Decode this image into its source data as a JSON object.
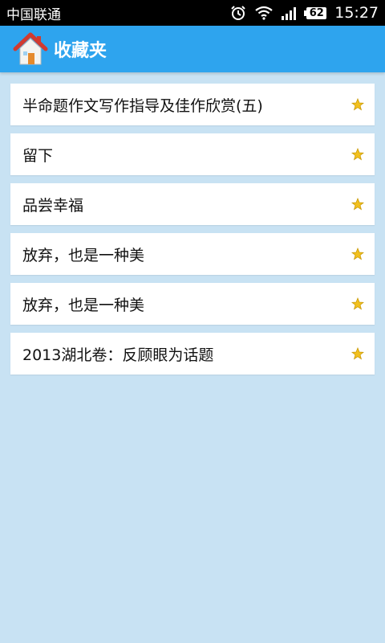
{
  "status_bar": {
    "carrier": "中国联通",
    "battery": "62",
    "time": "15:27",
    "icons": [
      "alarm-icon",
      "wifi-icon",
      "signal-icon",
      "battery-icon"
    ]
  },
  "header": {
    "title": "收藏夹",
    "icon": "home-icon",
    "color": "#2ea4ee"
  },
  "background_color": "#c8e2f3",
  "favorites": [
    {
      "title": "半命题作文写作指导及佳作欣赏(五)",
      "icon": "star-icon"
    },
    {
      "title": "留下",
      "icon": "star-icon"
    },
    {
      "title": "品尝幸福",
      "icon": "star-icon"
    },
    {
      "title": "放弃，也是一种美",
      "icon": "star-icon"
    },
    {
      "title": "放弃，也是一种美",
      "icon": "star-icon"
    },
    {
      "title": "2013湖北卷：反顾眼为话题",
      "icon": "star-icon"
    }
  ]
}
